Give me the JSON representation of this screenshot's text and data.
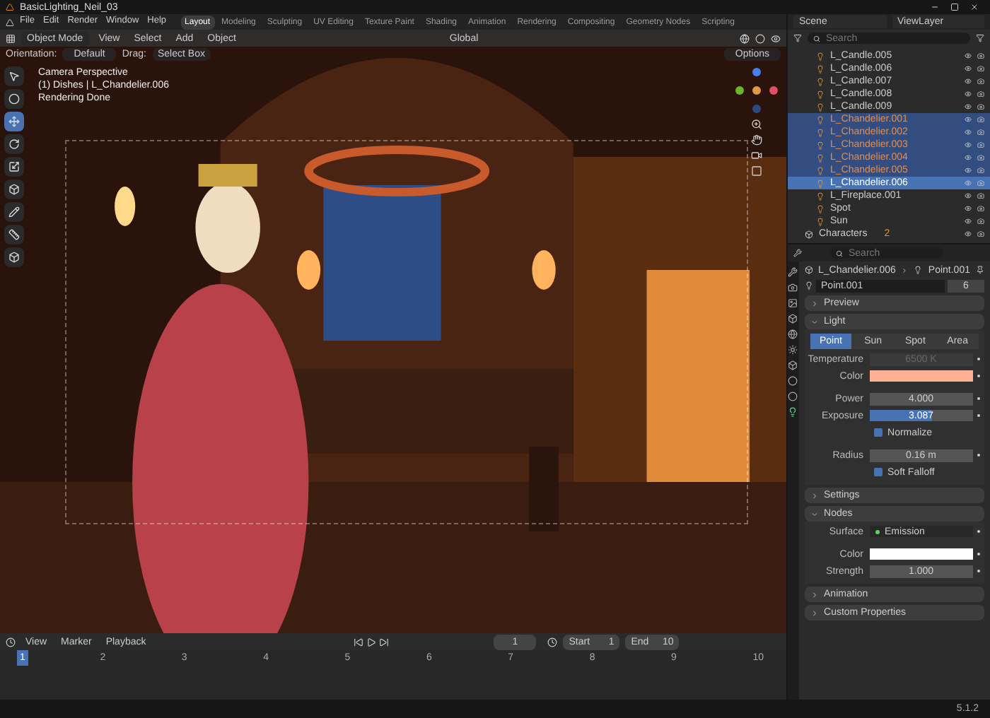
{
  "window": {
    "title": "BasicLighting_Neil_03"
  },
  "menu": [
    "File",
    "Edit",
    "Render",
    "Window",
    "Help"
  ],
  "workspaces": [
    {
      "label": "Layout",
      "selected": true
    },
    {
      "label": "Modeling",
      "selected": false
    },
    {
      "label": "Sculpting",
      "selected": false
    },
    {
      "label": "UV Editing",
      "selected": false
    },
    {
      "label": "Texture Paint",
      "selected": false
    },
    {
      "label": "Shading",
      "selected": false
    },
    {
      "label": "Animation",
      "selected": false
    },
    {
      "label": "Rendering",
      "selected": false
    },
    {
      "label": "Compositing",
      "selected": false
    },
    {
      "label": "Geometry Nodes",
      "selected": false
    },
    {
      "label": "Scripting",
      "selected": false
    }
  ],
  "viewport_header": {
    "mode": "Object Mode",
    "menus": [
      "View",
      "Select",
      "Add",
      "Object"
    ],
    "orientation": "Global"
  },
  "tool_settings": {
    "orientation_label": "Orientation:",
    "orientation": "Default",
    "drag_label": "Drag:",
    "drag": "Select Box",
    "options": "Options"
  },
  "viewport_info": [
    "Camera Perspective",
    "(1) Dishes | L_Chandelier.006",
    "Rendering Done"
  ],
  "tools": [
    {
      "selected": false
    },
    {
      "selected": false
    },
    {
      "selected": true
    },
    {
      "selected": false
    },
    {
      "selected": false
    },
    {
      "selected": false
    },
    {
      "selected": false
    },
    {
      "selected": false
    },
    {
      "selected": false
    }
  ],
  "outliner": {
    "scene": "Scene",
    "view_layer": "ViewLayer",
    "search_placeholder": "Search",
    "rows": [
      {
        "name": "L_Candle.005",
        "selected": false,
        "active": false
      },
      {
        "name": "L_Candle.006",
        "selected": false,
        "active": false
      },
      {
        "name": "L_Candle.007",
        "selected": false,
        "active": false
      },
      {
        "name": "L_Candle.008",
        "selected": false,
        "active": false
      },
      {
        "name": "L_Candle.009",
        "selected": false,
        "active": false
      },
      {
        "name": "L_Chandelier.001",
        "selected": true,
        "active": false
      },
      {
        "name": "L_Chandelier.002",
        "selected": true,
        "active": false
      },
      {
        "name": "L_Chandelier.003",
        "selected": true,
        "active": false
      },
      {
        "name": "L_Chandelier.004",
        "selected": true,
        "active": false
      },
      {
        "name": "L_Chandelier.005",
        "selected": true,
        "active": false
      },
      {
        "name": "L_Chandelier.006",
        "selected": true,
        "active": true
      },
      {
        "name": "L_Fireplace.001",
        "selected": false,
        "active": false
      },
      {
        "name": "Spot",
        "selected": false,
        "active": false
      },
      {
        "name": "Sun",
        "selected": false,
        "active": false
      }
    ],
    "collection": {
      "name": "Characters",
      "count": "2"
    }
  },
  "properties": {
    "search_placeholder": "Search",
    "object": "L_Chandelier.006",
    "data": "Point.001",
    "datablock": "Point.001",
    "users": "6",
    "preview": {
      "label": "Preview",
      "expanded": false
    },
    "light": {
      "label": "Light",
      "expanded": true,
      "types": [
        {
          "label": "Point",
          "selected": true
        },
        {
          "label": "Sun",
          "selected": false
        },
        {
          "label": "Spot",
          "selected": false
        },
        {
          "label": "Area",
          "selected": false
        }
      ],
      "temperature_label": "Temperature",
      "temperature": "6500 K",
      "temperature_disabled": true,
      "color_label": "Color",
      "color": "#ffb293",
      "power_label": "Power",
      "power": "4.000",
      "exposure_label": "Exposure",
      "exposure": {
        "value": "3.087",
        "level": 0.6
      },
      "normalize": {
        "label": "Normalize",
        "checked": true
      },
      "radius_label": "Radius",
      "radius": "0.16 m",
      "soft_falloff": {
        "label": "Soft Falloff",
        "checked": true
      }
    },
    "settings": {
      "label": "Settings",
      "expanded": false
    },
    "nodes": {
      "label": "Nodes",
      "expanded": true,
      "surface_label": "Surface",
      "surface": "Emission",
      "color_label": "Color",
      "color": "#ffffff",
      "strength_label": "Strength",
      "strength": "1.000"
    },
    "animation": {
      "label": "Animation",
      "expanded": false
    },
    "custom": {
      "label": "Custom Properties",
      "expanded": false
    }
  },
  "timeline": {
    "menus": [
      "View",
      "Marker",
      "Playback"
    ],
    "frame": "1",
    "start_label": "Start",
    "start": "1",
    "end_label": "End",
    "end": "10",
    "ticks": [
      "1",
      "2",
      "3",
      "4",
      "5",
      "6",
      "7",
      "8",
      "9",
      "10"
    ]
  },
  "status_bar": {
    "version": "5.1.2"
  }
}
